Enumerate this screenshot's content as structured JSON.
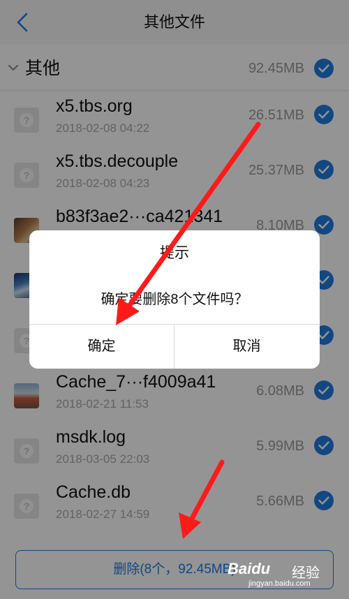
{
  "nav": {
    "title": "其他文件"
  },
  "group": {
    "title": "其他",
    "size": "92.45MB",
    "checked": true
  },
  "files": [
    {
      "name": "x5.tbs.org",
      "date": "2018-02-08 04:22",
      "size": "26.51MB",
      "icon": "unknown-file-icon"
    },
    {
      "name": "x5.tbs.decouple",
      "date": "2018-02-08 04:23",
      "size": "25.37MB",
      "icon": "unknown-file-icon"
    },
    {
      "name": "b83f3ae2···ca421341",
      "date": "",
      "size": "8.10MB",
      "icon": "image-thumbnail"
    },
    {
      "name": "",
      "date": "",
      "size": "",
      "icon": "image-thumbnail"
    },
    {
      "name": "",
      "date": "",
      "size": "",
      "icon": "unknown-file-icon"
    },
    {
      "name": "Cache_7···f4009a41",
      "date": "2018-02-21 11:53",
      "size": "6.08MB",
      "icon": "image-thumbnail"
    },
    {
      "name": "msdk.log",
      "date": "2018-03-05 22:03",
      "size": "5.99MB",
      "icon": "unknown-file-icon"
    },
    {
      "name": "Cache.db",
      "date": "2018-02-27 14:59",
      "size": "5.66MB",
      "icon": "unknown-file-icon"
    }
  ],
  "delete_button": {
    "label": "删除(8个，92.45MB)"
  },
  "dialog": {
    "title": "提示",
    "message": "确定要删除8个文件吗？",
    "confirm": "确定",
    "cancel": "取消"
  },
  "watermark": {
    "brand": "Baidu",
    "suffix": "经验",
    "url": "jingyan.baidu.com"
  },
  "colors": {
    "accent": "#1f7ae0",
    "arrow": "#ff1a1a",
    "overlay": "rgba(0,0,0,0.42)"
  }
}
